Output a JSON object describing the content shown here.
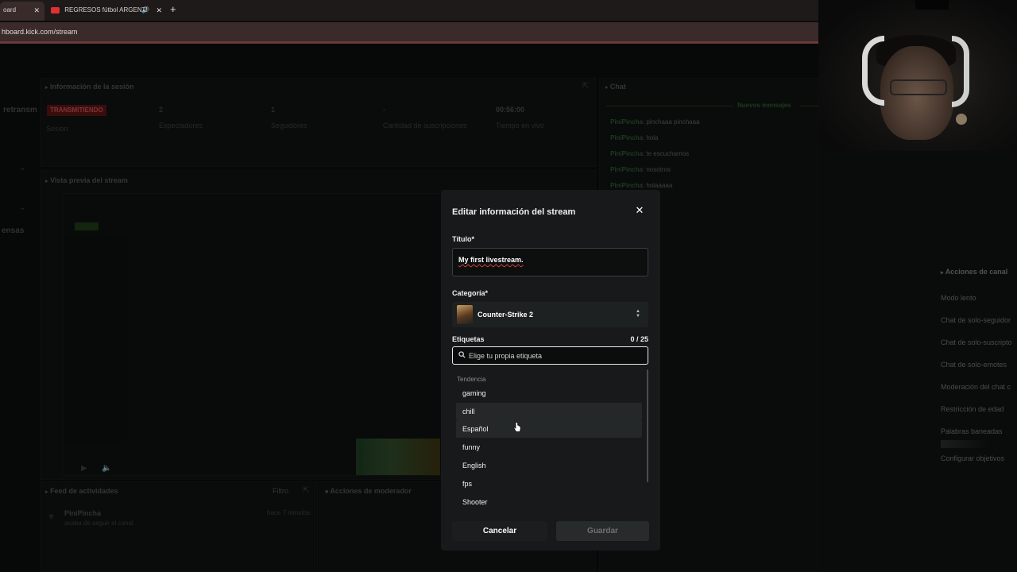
{
  "browser": {
    "tabs": [
      {
        "label": "oard",
        "active": true
      },
      {
        "label": "REGRESOS fútbol ARGENTI",
        "active": false
      }
    ],
    "new_tab": "+",
    "url": "hboard.kick.com/stream"
  },
  "session": {
    "header": "Información de la sesión",
    "left_cut_label": "retransm",
    "status_badge": "TRANSMITIENDO",
    "status_label": "Sesión",
    "stats": [
      {
        "value": "2",
        "label": "Espectadores"
      },
      {
        "value": "1",
        "label": "Seguidores"
      },
      {
        "value": "-",
        "label": "Cantidad de suscripciones"
      },
      {
        "value": "00:56:00",
        "label": "Tiempo en vivo"
      }
    ]
  },
  "preview": {
    "header": "Vista previa del stream",
    "left_cut_label": "ensas"
  },
  "activity": {
    "header": "Feed de actividades",
    "filter": "Filtro",
    "item_user": "PiniPincha",
    "item_text": "acaba de seguir el canal",
    "item_time": "hace 7 minutos"
  },
  "moderator": {
    "header": "Acciones de moderador"
  },
  "chat": {
    "header": "Chat",
    "new_messages": "Nuevos mensajes",
    "messages": [
      {
        "user": "PiniPincha",
        "text": ": pinchaaa pinchaaa"
      },
      {
        "user": "PiniPincha",
        "text": ": hola"
      },
      {
        "user": "PiniPincha",
        "text": ": te escuchamos"
      },
      {
        "user": "PiniPincha",
        "text": ": nosotros"
      },
      {
        "user": "PiniPincha",
        "text": ": holaaaaa"
      }
    ]
  },
  "channel_actions": {
    "header": "Acciones de canal",
    "items": [
      "Modo lento",
      "Chat de solo-seguidor",
      "Chat de solo-suscripto",
      "Chat de solo-emotes",
      "Moderación del chat c",
      "Restricción de edad",
      "Palabras baneadas",
      "Configurar objetivos"
    ]
  },
  "modal": {
    "title": "Editar información del stream",
    "title_label": "Título*",
    "title_value": "My first livestream.",
    "category_label": "Categoría*",
    "category_value": "Counter-Strike 2",
    "tags_label": "Etiquetas",
    "tags_count": "0 / 25",
    "tags_placeholder": "Elige tu propia etiqueta",
    "dropdown_header": "Tendencia",
    "options": [
      "gaming",
      "chill",
      "Español",
      "funny",
      "English",
      "fps",
      "Shooter"
    ],
    "hover_index": 1,
    "cancel": "Cancelar",
    "save": "Guardar"
  },
  "colors": {
    "accent_green": "#53fc18",
    "live_red": "#c62828",
    "modal_bg": "#17191a"
  }
}
